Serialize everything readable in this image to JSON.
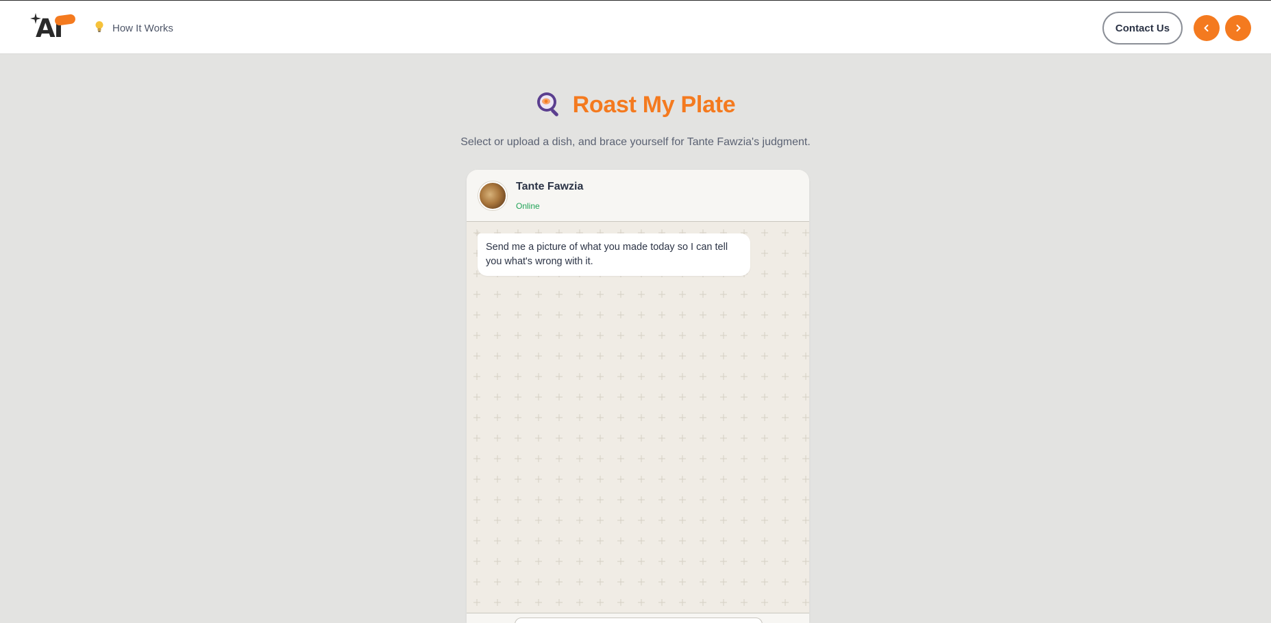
{
  "header": {
    "logo_text": "AI",
    "how_it_works_label": "How It Works",
    "contact_label": "Contact Us",
    "accent_color": "#f47a1f",
    "prev_icon": "chevron-left-icon",
    "next_icon": "chevron-right-icon"
  },
  "hero": {
    "title": "Roast My Plate",
    "subtitle": "Select or upload a dish, and brace yourself for Tante Fawzia's judgment.",
    "icon": "frying-pan-icon"
  },
  "chat": {
    "contact_name": "Tante Fawzia",
    "status": "Online",
    "status_color": "#1fa356",
    "messages": [
      {
        "from": "Tante Fawzia",
        "text": "Send me a picture of what you made today so I can tell you what's wrong with it."
      }
    ]
  }
}
